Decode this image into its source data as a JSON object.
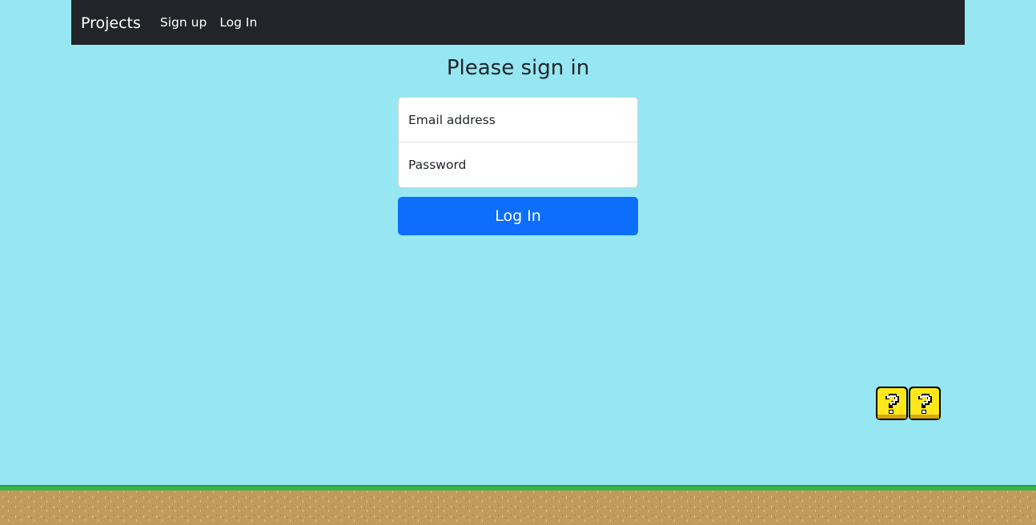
{
  "navbar": {
    "brand": "Projects",
    "links": [
      {
        "label": "Sign up"
      },
      {
        "label": "Log In"
      }
    ]
  },
  "page": {
    "title": "Please sign in"
  },
  "form": {
    "email_placeholder": "Email address",
    "password_placeholder": "Password",
    "submit_label": "Log In"
  },
  "colors": {
    "background": "#96e7f2",
    "navbar": "#212529",
    "primary_button": "#0d6efd",
    "block_fill": "#ffe81a",
    "grass": "#3cb34a",
    "dirt": "#c29a5c"
  },
  "decorations": {
    "blocks": [
      {
        "icon": "question-block-icon"
      },
      {
        "icon": "question-block-icon"
      }
    ],
    "ground_icon": "grass-ground"
  }
}
